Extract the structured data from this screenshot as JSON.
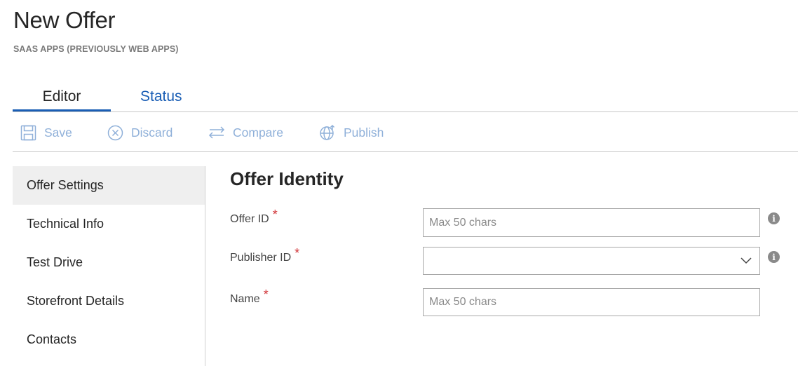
{
  "header": {
    "title": "New Offer",
    "subtitle": "SAAS APPS (PREVIOUSLY WEB APPS)"
  },
  "tabs": [
    {
      "label": "Editor",
      "active": true
    },
    {
      "label": "Status",
      "active": false
    }
  ],
  "toolbar": {
    "save_label": "Save",
    "discard_label": "Discard",
    "compare_label": "Compare",
    "publish_label": "Publish"
  },
  "sidebar": {
    "items": [
      {
        "label": "Offer Settings",
        "active": true
      },
      {
        "label": "Technical Info",
        "active": false
      },
      {
        "label": "Test Drive",
        "active": false
      },
      {
        "label": "Storefront Details",
        "active": false
      },
      {
        "label": "Contacts",
        "active": false
      }
    ]
  },
  "form": {
    "section_title": "Offer Identity",
    "required_marker": "*",
    "info_glyph": "i",
    "offer_id": {
      "label": "Offer ID",
      "value": "",
      "placeholder": "Max 50 chars"
    },
    "publisher_id": {
      "label": "Publisher ID",
      "value": ""
    },
    "name": {
      "label": "Name",
      "value": "",
      "placeholder": "Max 50 chars"
    }
  },
  "colors": {
    "accent": "#1a5eb5",
    "toolbar_disabled": "#8fb0d9",
    "required": "#d13438",
    "active_nav_bg": "#efefef"
  },
  "icons": {
    "save": "save-icon",
    "discard": "discard-icon",
    "compare": "compare-icon",
    "publish": "globe-icon",
    "dropdown": "chevron-down-icon",
    "info": "info-icon"
  }
}
